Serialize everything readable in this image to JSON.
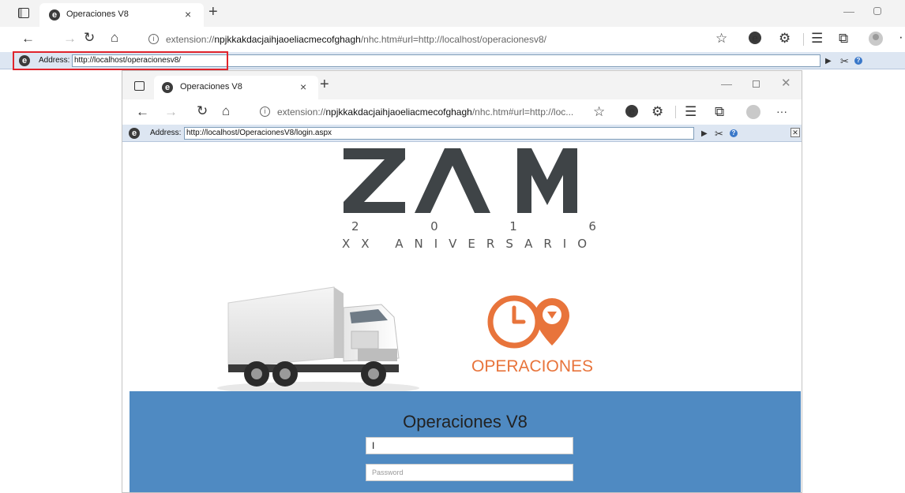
{
  "outer": {
    "tab_title": "Operaciones V8",
    "tab_close": "×",
    "new_tab": "+",
    "url_prefix": "extension://",
    "url_main": "npjkkakdacjaihjaoeliacmecofghagh",
    "url_suffix": "/nhc.htm#url=http://localhost/operacionesv8/",
    "address_label": "Address:",
    "address_value": "http://localhost/operacionesv8/"
  },
  "inner": {
    "tab_title": "Operaciones V8",
    "tab_close": "×",
    "new_tab": "+",
    "url_prefix": "extension://",
    "url_main": "npjkkakdacjaihjaoeliacmecofghagh",
    "url_suffix": "/nhc.htm#url=http://loc...",
    "address_label": "Address:",
    "address_value": "http://localhost/OperacionesV8/login.aspx"
  },
  "page": {
    "logo_text": "ZΛM",
    "year_digits": [
      "2",
      "0",
      "1",
      "6"
    ],
    "anniversary": "XX ANIVERSARIO",
    "ops_label": "OPERACIONES",
    "login_title": "Operaciones V8",
    "username_value": "I",
    "password_placeholder": "Password"
  },
  "colors": {
    "login_panel": "#4f8ac2",
    "ops_orange": "#e8743b",
    "logo_gray": "#3f4447",
    "highlight": "#e0242c"
  },
  "icons": {
    "back": "back-arrow-icon",
    "forward": "forward-arrow-icon",
    "refresh": "refresh-icon",
    "home": "home-icon",
    "favorite": "add-favorite-icon",
    "extensions": "extensions-icon",
    "favorites": "favorites-icon",
    "collections": "collections-icon",
    "more": "more-icon"
  }
}
